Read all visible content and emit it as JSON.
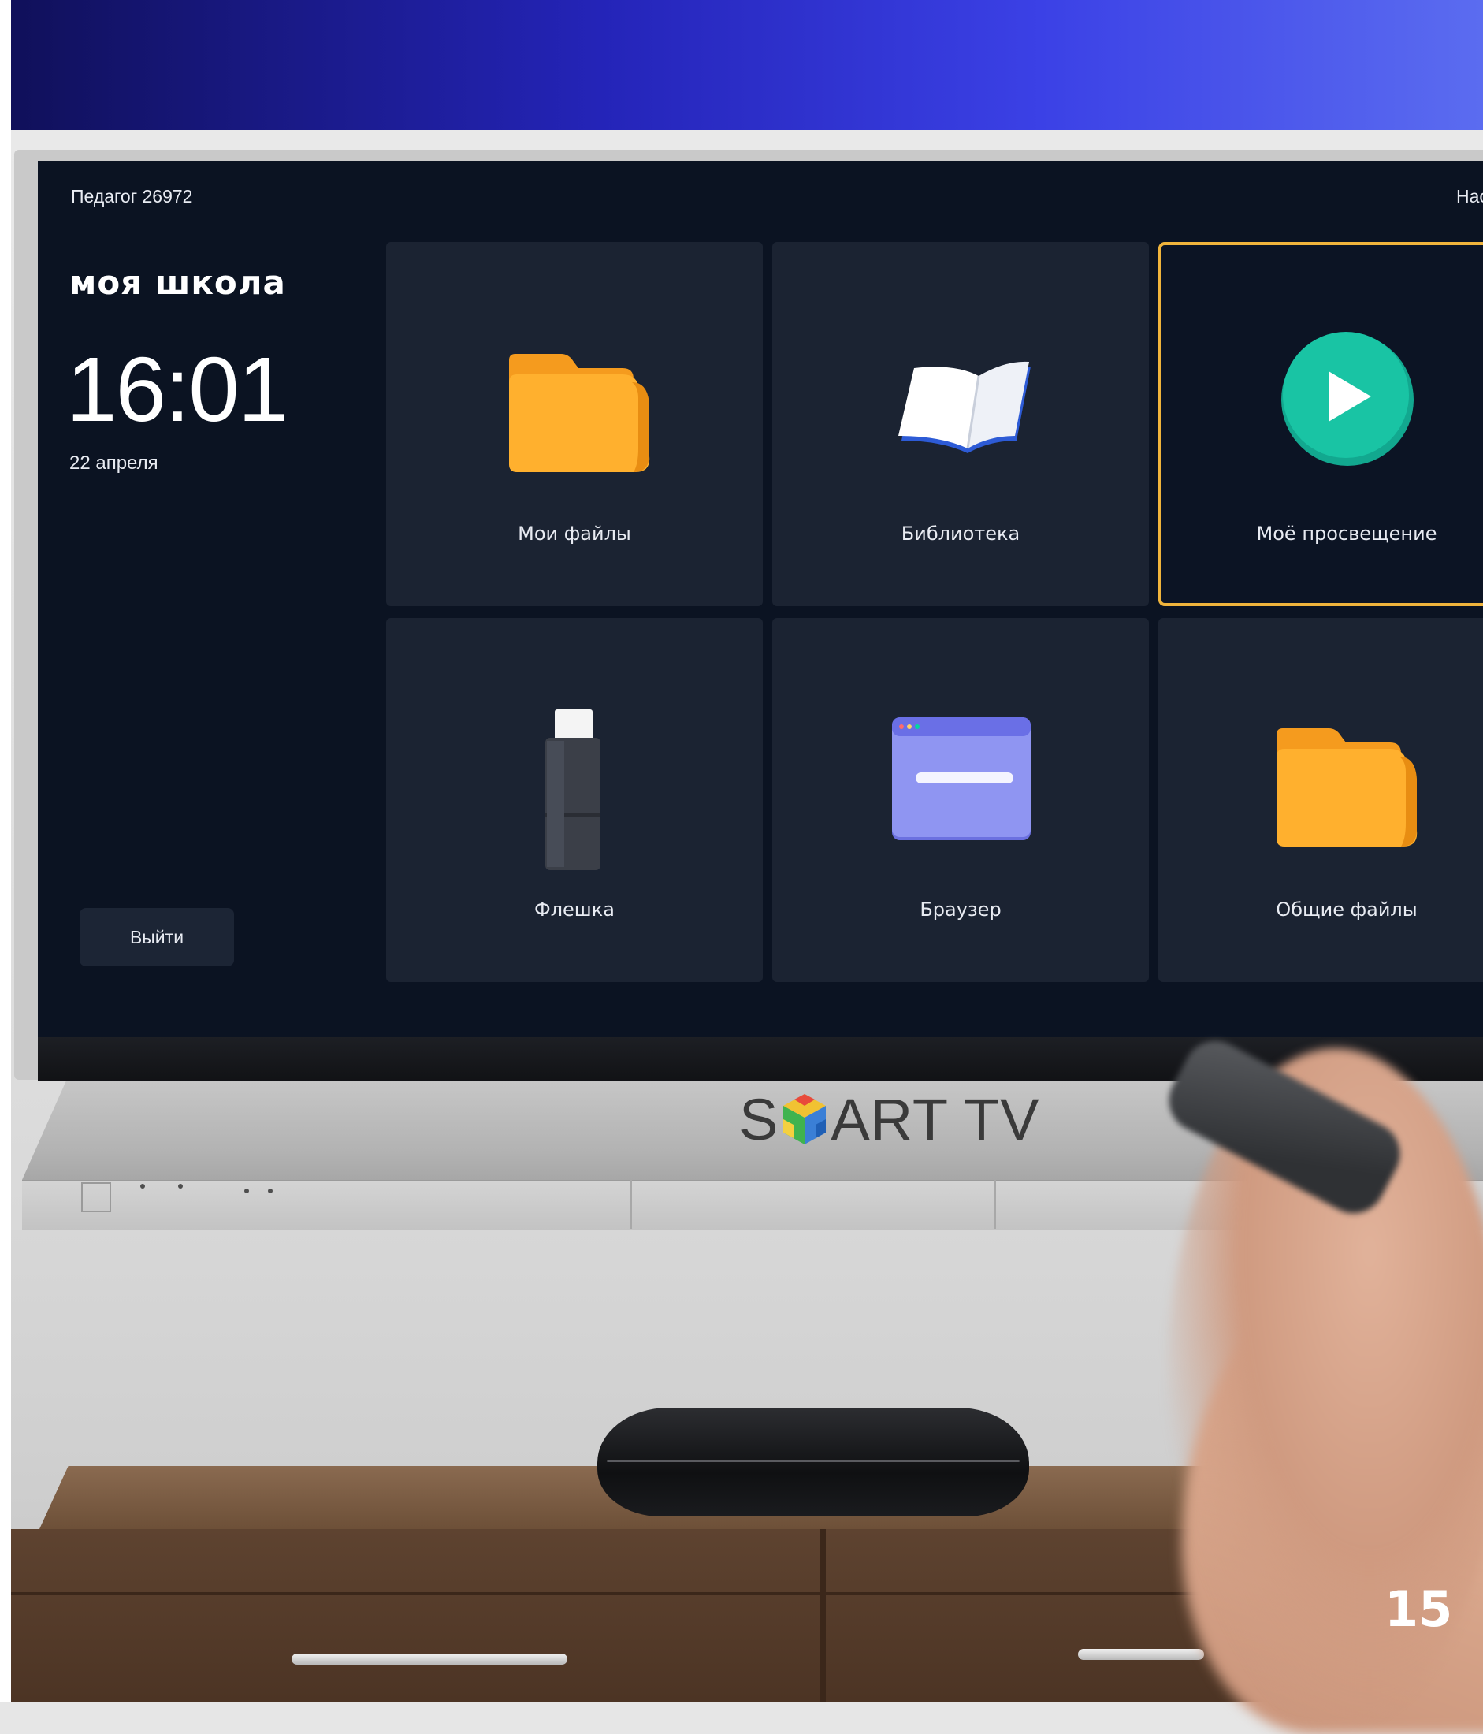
{
  "screen": {
    "user_name": "Педагог 26972",
    "top_right_text": "Нас",
    "app_title": "моя школа",
    "clock": "16:01",
    "date": "22 апреля",
    "logout_label": "Выйти",
    "tiles": [
      {
        "label": "Мои файлы",
        "icon": "folder-icon"
      },
      {
        "label": "Библиотека",
        "icon": "book-icon"
      },
      {
        "label": "Моё просвещение",
        "icon": "play-icon",
        "selected": true
      },
      {
        "label": "Флешка",
        "icon": "usb-drive-icon"
      },
      {
        "label": "Браузер",
        "icon": "browser-icon"
      },
      {
        "label": "Общие файлы",
        "icon": "folder-icon"
      }
    ],
    "accent_color": "#f0b43c",
    "background_color": "#0b1322",
    "tile_color": "#1b2332"
  },
  "tv": {
    "brand_prefix": "S",
    "brand_suffix": "ART TV"
  },
  "page_number": "15",
  "colors": {
    "banner_start": "#10105a",
    "banner_end": "#5b6cf0",
    "folder": "#ffb02e",
    "play": "#19c4a4",
    "browser": "#8f95f2"
  }
}
